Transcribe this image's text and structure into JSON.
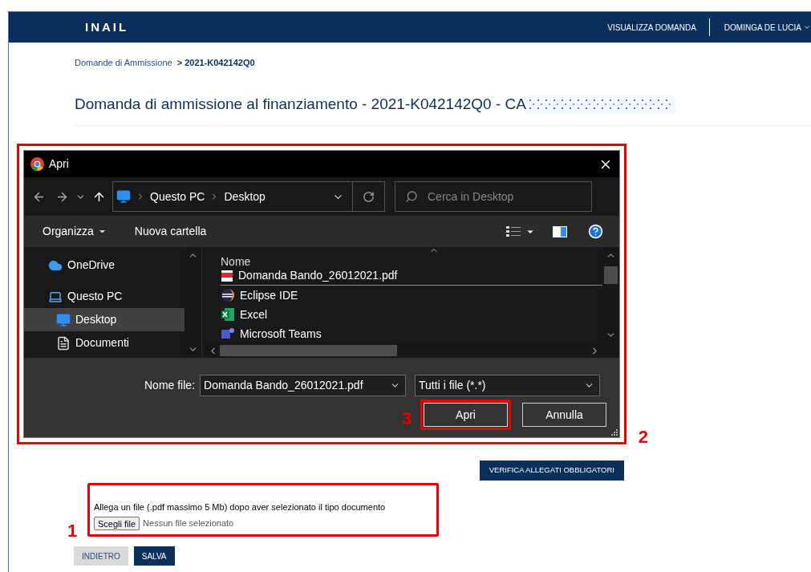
{
  "header": {
    "logo": "INAIL",
    "nav": [
      {
        "label": "VISUALIZZA DOMANDA",
        "dropdown": false
      },
      {
        "label": "DOMINGA DE LUCIA",
        "dropdown": true
      }
    ]
  },
  "breadcrumb": [
    {
      "label": "Domande di Ammissione",
      "current": false
    },
    {
      "label": "> 2021-K042142Q0",
      "current": true
    }
  ],
  "title": "Domanda di ammissione al finanziamento - 2021-K042142Q0 - CA",
  "dialog": {
    "title": "Apri",
    "path": [
      "Questo PC",
      "Desktop"
    ],
    "search": {
      "placeholder": "Cerca in Desktop"
    },
    "toolbar": {
      "organize": "Organizza",
      "new_folder": "Nuova cartella"
    },
    "nav_items": [
      {
        "label": "OneDrive",
        "kind": "cloud",
        "selected": false
      },
      {
        "label": "Questo PC",
        "kind": "pc",
        "selected": false,
        "children": [
          {
            "label": "Desktop",
            "kind": "desktop",
            "selected": true
          },
          {
            "label": "Documenti",
            "kind": "docs",
            "selected": false
          }
        ]
      }
    ],
    "column": "Nome",
    "files": [
      {
        "name": "Domanda Bando_26012021.pdf",
        "kind": "pdf",
        "selected": true
      },
      {
        "name": "Eclipse IDE",
        "kind": "eclipse",
        "selected": false
      },
      {
        "name": "Excel",
        "kind": "excel",
        "selected": false
      },
      {
        "name": "Microsoft Teams",
        "kind": "teams",
        "selected": false
      }
    ],
    "filename_label": "Nome file:",
    "filename": "Domanda Bando_26012021.pdf",
    "filter": "Tutti i file (*.*)",
    "buttons": [
      {
        "label": "Apri",
        "kind": "primary"
      },
      {
        "label": "Annulla",
        "kind": "secondary"
      }
    ]
  },
  "verify_button": "VERIFICA ALLEGATI OBBLIGATORI",
  "upload": {
    "label": "Allega un file (.pdf massimo 5 Mb) dopo aver selezionato il tipo documento",
    "button": "Scegli file",
    "status": "Nessun file selezionato"
  },
  "actions": [
    {
      "label": "INDIETRO",
      "kind": "secondary"
    },
    {
      "label": "SALVA",
      "kind": "primary"
    }
  ],
  "annotations": [
    "1",
    "2",
    "3"
  ]
}
